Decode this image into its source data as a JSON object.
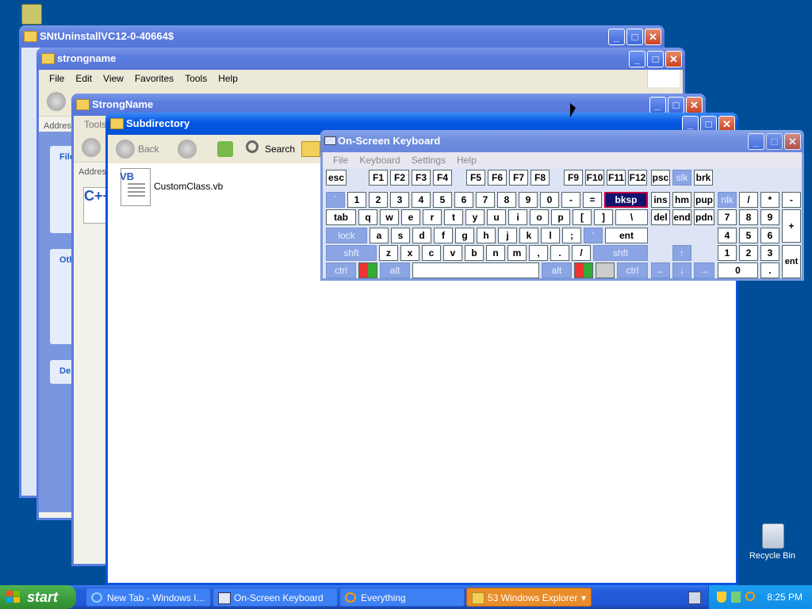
{
  "windows": [
    {
      "title": "SNtUninstallVC12-0-40664$"
    },
    {
      "title": "strongname"
    },
    {
      "title": "StrongName"
    },
    {
      "title": "Subdirectory"
    }
  ],
  "explorer": {
    "menu": [
      "File",
      "Edit",
      "View",
      "Favorites",
      "Tools",
      "Help"
    ],
    "back_label": "Back",
    "search_label": "Search",
    "tools_label": "Tools",
    "address_label": "Address",
    "address_short": "Addres",
    "file_name": "CustomClass.vb",
    "side_task_heading": "File",
    "side_other_heading": "Oth",
    "side_details_heading": "De"
  },
  "osk": {
    "title": "On-Screen Keyboard",
    "menu": [
      "File",
      "Keyboard",
      "Settings",
      "Help"
    ],
    "row_fn": [
      "esc",
      "F1",
      "F2",
      "F3",
      "F4",
      "F5",
      "F6",
      "F7",
      "F8",
      "F9",
      "F10",
      "F11",
      "F12",
      "psc",
      "slk",
      "brk"
    ],
    "row_num": [
      "`",
      "1",
      "2",
      "3",
      "4",
      "5",
      "6",
      "7",
      "8",
      "9",
      "0",
      "-",
      "=",
      "bksp",
      "ins",
      "hm",
      "pup",
      "nlk",
      "/",
      "*",
      "-"
    ],
    "row_tab": [
      "tab",
      "q",
      "w",
      "e",
      "r",
      "t",
      "y",
      "u",
      "i",
      "o",
      "p",
      "[",
      "]",
      "\\",
      "del",
      "end",
      "pdn",
      "7",
      "8",
      "9",
      "+"
    ],
    "row_caps": [
      "lock",
      "a",
      "s",
      "d",
      "f",
      "g",
      "h",
      "j",
      "k",
      "l",
      ";",
      "'",
      "ent",
      "4",
      "5",
      "6"
    ],
    "row_shift": [
      "shft",
      "z",
      "x",
      "c",
      "v",
      "b",
      "n",
      "m",
      ",",
      ".",
      "/",
      "shft",
      "↑",
      "1",
      "2",
      "3",
      "ent"
    ],
    "row_ctrl": [
      "ctrl",
      "alt",
      "alt",
      "ctrl",
      "←",
      "↓",
      "→",
      "0",
      "."
    ]
  },
  "desktop": {
    "recycle_bin_label": "Recycle Bin"
  },
  "taskbar": {
    "start_label": "start",
    "tasks": [
      {
        "label": "New Tab - Windows I..."
      },
      {
        "label": "On-Screen Keyboard"
      },
      {
        "label": "Everything"
      },
      {
        "label": "53 Windows Explorer"
      }
    ],
    "clock": "8:25 PM"
  }
}
